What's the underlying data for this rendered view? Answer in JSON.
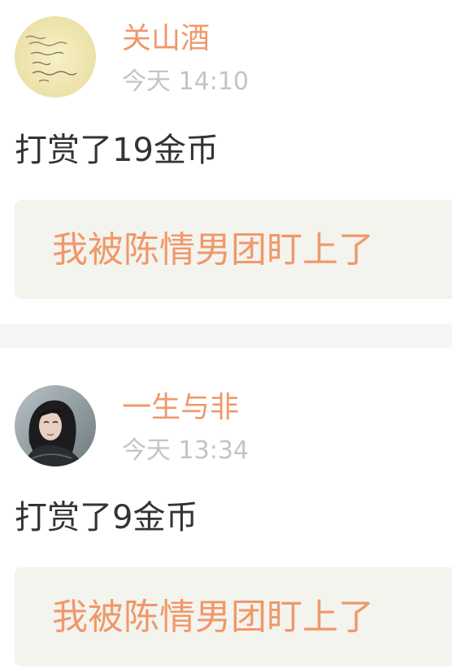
{
  "colors": {
    "accent": "#f0986a",
    "timestamp": "#c4c4c4",
    "body_text": "#333333",
    "quote_background": "#f4f4ef",
    "divider": "#f6f6f6"
  },
  "feed": {
    "items": [
      {
        "username": "关山酒",
        "timestamp": "今天 14:10",
        "action": "打赏了19金币",
        "quote": "我被陈情男团盯上了",
        "avatar_icon": "handwritten-note-avatar"
      },
      {
        "username": "一生与非",
        "timestamp": "今天 13:34",
        "action": "打赏了9金币",
        "quote": "我被陈情男团盯上了",
        "avatar_icon": "costumed-character-avatar"
      }
    ]
  }
}
